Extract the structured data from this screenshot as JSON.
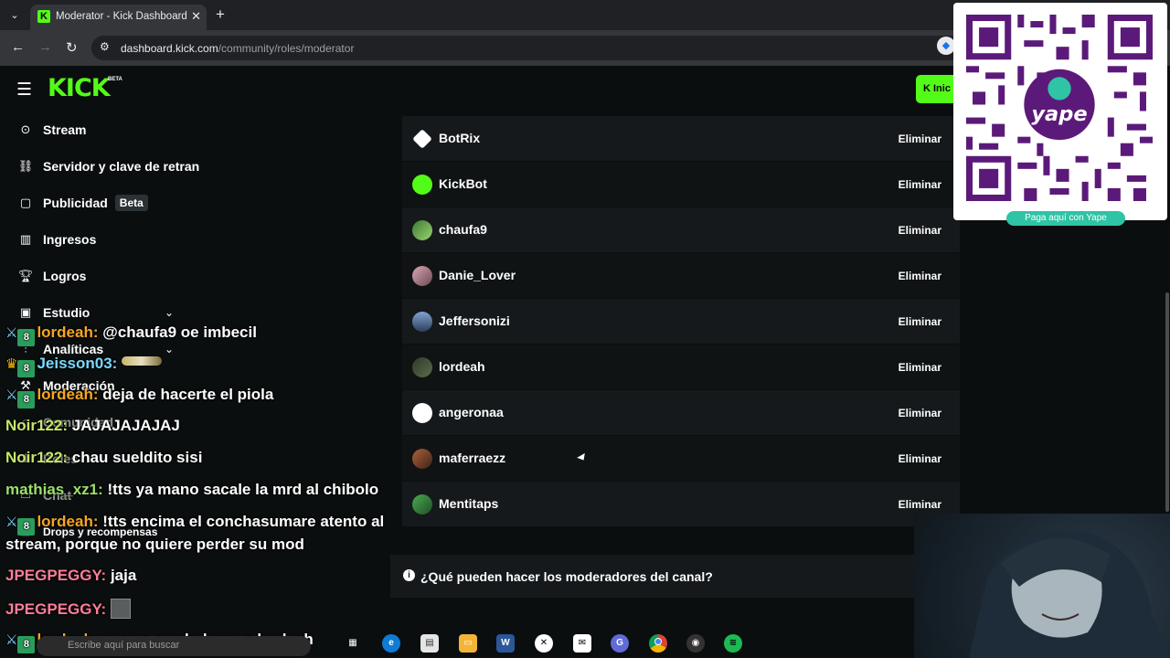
{
  "browser": {
    "tab_title": "Moderator - Kick Dashboard",
    "url_host": "dashboard.kick.com",
    "url_path": "/community/roles/moderator"
  },
  "header": {
    "logo": "KICK",
    "logo_badge": "BETA",
    "start_button": "Inic",
    "accent_color": "#53fc18"
  },
  "sidebar": {
    "items": [
      {
        "label": "Stream",
        "icon": "broadcast-icon"
      },
      {
        "label": "Servidor y clave de retran",
        "icon": "link-icon"
      },
      {
        "label": "Publicidad",
        "icon": "ad-icon",
        "badge": "Beta"
      },
      {
        "label": "Ingresos",
        "icon": "chart-icon"
      },
      {
        "label": "Logros",
        "icon": "trophy-icon"
      },
      {
        "label": "Estudio",
        "icon": "studio-icon"
      },
      {
        "label": "Analíticas",
        "icon": "analytics-icon"
      },
      {
        "label": "Moderación",
        "icon": "moderation-icon"
      },
      {
        "label": "Comunidad",
        "icon": "community-icon"
      },
      {
        "label": "Roles",
        "icon": "roles-icon"
      },
      {
        "label": "Chat",
        "icon": "chat-icon"
      },
      {
        "label": "Drops y recompensas",
        "icon": "gift-icon"
      }
    ]
  },
  "chat": [
    {
      "user": "lordeah:",
      "msg": "@chaufa9 oe imbecil"
    },
    {
      "user": "Jeisson03:",
      "msg": ""
    },
    {
      "user": "lordeah:",
      "msg": "deja de hacerte el piola"
    },
    {
      "user": "Noir122:",
      "msg": "JAJAJAJAJAJ"
    },
    {
      "user": "Noir122:",
      "msg": "chau sueldito sisi"
    },
    {
      "user": "mathias_xz1:",
      "msg": "!tts ya mano sacale la mrd al chibolo"
    },
    {
      "user": "lordeah:",
      "msg": "!tts encima el conchasumare atento al"
    },
    {
      "user": "",
      "msg": "stream, porque no quiere perder su mod"
    },
    {
      "user": "JPEGPEGGY:",
      "msg": "jaja"
    },
    {
      "user": "JPEGPEGGY:",
      "msg": ""
    },
    {
      "user": "lordeah:",
      "msg": "saca a ese baboso a lordeah"
    }
  ],
  "moderators": [
    {
      "name": "BotRix",
      "action": "Eliminar"
    },
    {
      "name": "KickBot",
      "action": "Eliminar"
    },
    {
      "name": "chaufa9",
      "action": "Eliminar"
    },
    {
      "name": "Danie_Lover",
      "action": "Eliminar"
    },
    {
      "name": "Jeffersonizi",
      "action": "Eliminar"
    },
    {
      "name": "lordeah",
      "action": "Eliminar"
    },
    {
      "name": "angeronaa",
      "action": "Eliminar"
    },
    {
      "name": "maferraezz",
      "action": "Eliminar"
    },
    {
      "name": "Mentitaps",
      "action": "Eliminar"
    }
  ],
  "info": {
    "question": "¿Qué pueden hacer los moderadores del canal?"
  },
  "qr": {
    "brand": "yape",
    "caption": "Paga aquí con Yape"
  },
  "taskbar": {
    "search_placeholder": "Escribe aquí para buscar"
  }
}
